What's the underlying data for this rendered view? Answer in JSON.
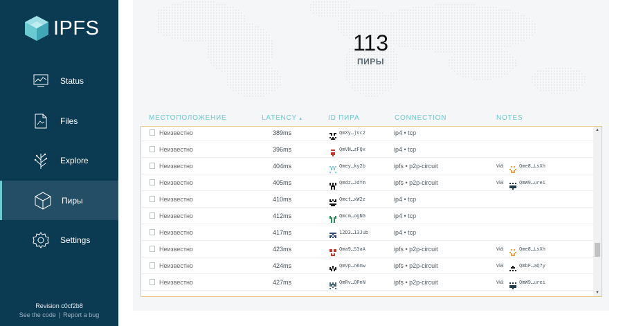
{
  "app": {
    "logo_text": "IPFS"
  },
  "nav": [
    {
      "label": "Status",
      "icon": "status-chart-icon"
    },
    {
      "label": "Files",
      "icon": "files-icon"
    },
    {
      "label": "Explore",
      "icon": "explore-tree-icon"
    },
    {
      "label": "Пиры",
      "icon": "peers-cube-icon",
      "active": true
    },
    {
      "label": "Settings",
      "icon": "settings-gear-icon"
    }
  ],
  "footer": {
    "revision": "Revision c0cf2b8",
    "see_code": "See the code",
    "separator": "|",
    "report_bug": "Report a bug"
  },
  "summary": {
    "count": "113",
    "label": "ПИРЫ"
  },
  "columns": {
    "location": "МЕСТОПОЛОЖЕНИЕ",
    "latency": "LATENCY",
    "latency_sort": "▴",
    "peer_id": "ID ПИРА",
    "connection": "CONNECTION",
    "notes": "NOTES"
  },
  "rows": [
    {
      "location": "Неизвестно",
      "latency": "389ms",
      "peer_id": "QmXy…jVc2",
      "connection": "ip4 • tcp",
      "via": "",
      "via_id": "",
      "icon_color": "#1a1a1a",
      "via_color": ""
    },
    {
      "location": "Неизвестно",
      "latency": "396ms",
      "peer_id": "QmVN…zFQx",
      "connection": "ip4 • tcp",
      "via": "",
      "via_id": "",
      "icon_color": "#c0392b",
      "via_color": ""
    },
    {
      "location": "Неизвестно",
      "latency": "404ms",
      "peer_id": "Qmey…ky2b",
      "connection": "ipfs • p2p-circuit",
      "via": "via",
      "via_id": "Qme8…LsXh",
      "icon_color": "#7fc6d6",
      "via_color": "#e8a33c"
    },
    {
      "location": "Неизвестно",
      "latency": "405ms",
      "peer_id": "Qmdz…JdYm",
      "connection": "ipfs • p2p-circuit",
      "via": "via",
      "via_id": "QmW9…urei",
      "icon_color": "#1a1a1a",
      "via_color": "#1f3a4a"
    },
    {
      "location": "Неизвестно",
      "latency": "410ms",
      "peer_id": "Qmct…xW2z",
      "connection": "ip4 • tcp",
      "via": "",
      "via_id": "",
      "icon_color": "#1a1a1a",
      "via_color": ""
    },
    {
      "location": "Неизвестно",
      "latency": "412ms",
      "peer_id": "Qmcm…ogNG",
      "connection": "ip4 • tcp",
      "via": "",
      "via_id": "",
      "icon_color": "#2e8b57",
      "via_color": ""
    },
    {
      "location": "Неизвестно",
      "latency": "417ms",
      "peer_id": "12D3…13Jub",
      "connection": "ip4 • tcp",
      "via": "",
      "via_id": "",
      "icon_color": "#2c4a7a",
      "via_color": ""
    },
    {
      "location": "Неизвестно",
      "latency": "423ms",
      "peer_id": "Qma9…S3aA",
      "connection": "ipfs • p2p-circuit",
      "via": "via",
      "via_id": "Qme8…LsXh",
      "icon_color": "#c0392b",
      "via_color": "#e8a33c"
    },
    {
      "location": "Неизвестно",
      "latency": "424ms",
      "peer_id": "QmVp…n6mw",
      "connection": "ipfs • p2p-circuit",
      "via": "via",
      "via_id": "QmbF…aQ7y",
      "icon_color": "#1a1a1a",
      "via_color": "#1a1a1a"
    },
    {
      "location": "Неизвестно",
      "latency": "427ms",
      "peer_id": "QmRv…QPnN",
      "connection": "ipfs • p2p-circuit",
      "via": "via",
      "via_id": "QmW9…urei",
      "icon_color": "#4a6a7a",
      "via_color": "#1f3a4a"
    }
  ],
  "colors": {
    "sidebar": "#0b3a53",
    "accent": "#6acad1",
    "table_border": "#e5c880"
  }
}
